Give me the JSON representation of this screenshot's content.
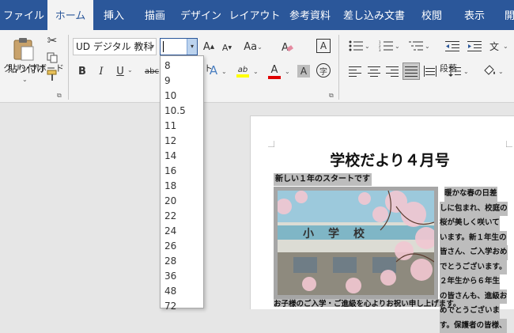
{
  "tabs": [
    "ファイル",
    "ホーム",
    "挿入",
    "描画",
    "デザイン",
    "レイアウト",
    "参考資料",
    "差し込み文書",
    "校閲",
    "表示",
    "開"
  ],
  "ribbon": {
    "paste_label": "貼り付け",
    "clipboard_group_label": "クリップボード",
    "font_group_label_partial": "ト",
    "paragraph_group_label": "段落",
    "font_name": "UD デジタル 教科",
    "font_size_value": "",
    "bold": "B",
    "italic": "I",
    "underline": "U",
    "strikethrough": "abc",
    "change_case": "Aa",
    "clear_format": "A",
    "ruby": "字"
  },
  "font_sizes": [
    "8",
    "9",
    "10",
    "10.5",
    "11",
    "12",
    "14",
    "16",
    "18",
    "20",
    "22",
    "24",
    "26",
    "28",
    "36",
    "48",
    "72"
  ],
  "document": {
    "title": "学校だより４月号",
    "heading": "新しい１年のスタートです",
    "photo_sign": "小　学　校",
    "body_lines": [
      "暖かな春の日差",
      "しに包まれ、校庭の",
      "桜が美しく咲いて",
      "います。新１年生の",
      "皆さん、ご入学おめ",
      "でとうございます。",
      "２年生から６年生",
      "の皆さんも、進級お",
      "めでとうございま",
      "す。保護者の皆様、"
    ],
    "bottom_line": "お子様のご入学・ご進級を心よりお祝い申し上げます。"
  },
  "colors": {
    "brand": "#2b579a",
    "highlight": "#ffff00",
    "font_color": "#e00000",
    "ribbon_bg": "#f3f3f3"
  }
}
